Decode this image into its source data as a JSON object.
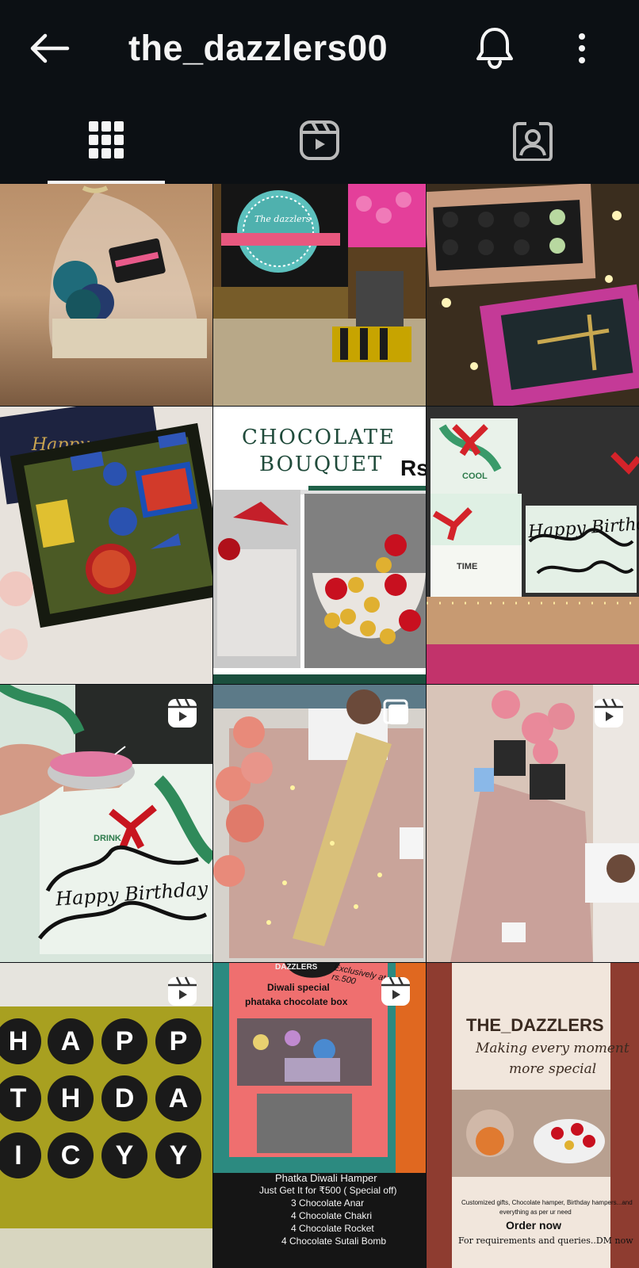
{
  "header": {
    "username": "the_dazzlers00",
    "icons": [
      "back-arrow-icon",
      "bell-icon",
      "more-vertical-icon"
    ]
  },
  "tabs": [
    {
      "name": "posts-grid",
      "icon": "grid-icon",
      "active": true
    },
    {
      "name": "reels",
      "icon": "reels-icon",
      "active": false
    },
    {
      "name": "tagged",
      "icon": "tagged-person-icon",
      "active": false
    }
  ],
  "posts": {
    "p2": {
      "logo": "The dazzlers"
    },
    "p5": {
      "line1": "CHOCOLATE",
      "line2": "BOUQUET",
      "price": "Rs"
    },
    "p6": {
      "cool": "COOL",
      "time": "TIME",
      "script": "Happy Birthday"
    },
    "p7": {
      "drink": "DRINK",
      "script": "Happy Birthday"
    },
    "p10": {
      "letters": [
        "H",
        "A",
        "P",
        "P",
        "T",
        "H",
        "D",
        "A",
        "I",
        "C",
        "Y",
        "Y"
      ]
    },
    "p11": {
      "brand": "DAZZLERS",
      "exclusive": "Exclusively at rs.500",
      "title1": "Diwali special",
      "title2": "phataka chocolate box",
      "lines": [
        "Phatka Diwali Hamper",
        "Just Get It for ₹500 ( Special off)",
        "3 Chocolate Anar",
        "4 Chocolate Chakri",
        "4 Chocolate Rocket",
        "4 Chocolate Sutali Bomb"
      ]
    },
    "p12": {
      "brand": "THE_DAZZLERS",
      "tagline1": "Making every moment",
      "tagline2": "more special",
      "desc1": "Customized gifts, Chocolate hamper, Birthday hampers...and",
      "desc2": "everything as per ur need",
      "order": "Order now",
      "contact": "For requirements and queries..DM now"
    }
  },
  "colors": {
    "background": "#0c1014",
    "text": "#f5f5f5",
    "pink_accent": "#c2185b",
    "teal_accent": "#3aa8a8"
  }
}
